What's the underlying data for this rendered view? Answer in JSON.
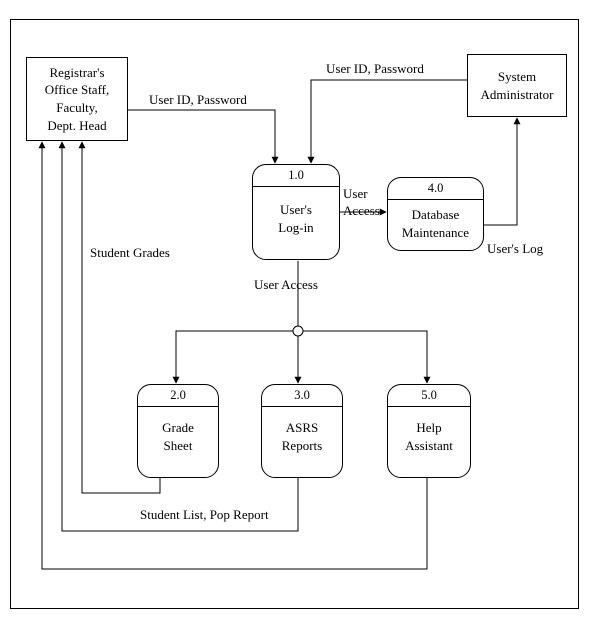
{
  "entities": {
    "registrar": "Registrar's\nOffice Staff,\nFaculty,\nDept. Head",
    "sysadmin": "System\nAdministrator"
  },
  "processes": {
    "p1": {
      "id": "1.0",
      "name": "User's\nLog-in"
    },
    "p2": {
      "id": "2.0",
      "name": "Grade\nSheet"
    },
    "p3": {
      "id": "3.0",
      "name": "ASRS\nReports"
    },
    "p4": {
      "id": "4.0",
      "name": "Database\nMaintenance"
    },
    "p5": {
      "id": "5.0",
      "name": "Help\nAssistant"
    }
  },
  "flows": {
    "f1": "User ID, Password",
    "f2": "User ID, Password",
    "f3": "User\nAccess",
    "f4": "User's Log",
    "f5": "User Access",
    "f6": "Student Grades",
    "f7": "Student List, Pop Report"
  }
}
